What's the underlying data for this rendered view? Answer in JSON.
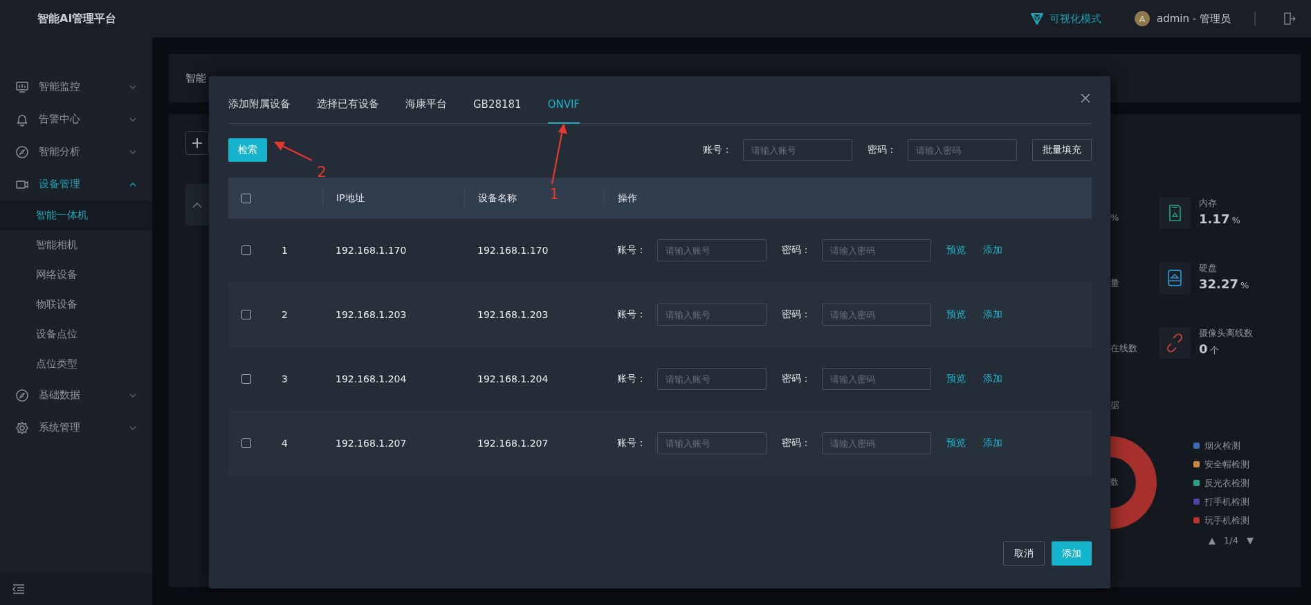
{
  "header": {
    "title": "智能AI管理平台",
    "mode_link": "可视化模式",
    "avatar": "A",
    "user": "admin - 管理员"
  },
  "sidebar": {
    "items": [
      {
        "label": "智能监控",
        "expanded": false,
        "selected": false
      },
      {
        "label": "告警中心",
        "expanded": false,
        "selected": false
      },
      {
        "label": "智能分析",
        "expanded": false,
        "selected": false
      },
      {
        "label": "设备管理",
        "expanded": true,
        "selected": true,
        "children": [
          {
            "label": "智能一体机",
            "selected": true
          },
          {
            "label": "智能相机",
            "selected": false
          },
          {
            "label": "网络设备",
            "selected": false
          },
          {
            "label": "物联设备",
            "selected": false
          },
          {
            "label": "设备点位",
            "selected": false
          },
          {
            "label": "点位类型",
            "selected": false
          }
        ]
      },
      {
        "label": "基础数据",
        "expanded": false,
        "selected": false
      },
      {
        "label": "系统管理",
        "expanded": false,
        "selected": false
      }
    ]
  },
  "breadcrumb": "智能",
  "dashboard": {
    "fragments": [
      "%",
      "量",
      "在线数"
    ],
    "stats": [
      {
        "label": "内存",
        "value": "1.17",
        "unit": "%"
      },
      {
        "label": "硬盘",
        "value": "32.27",
        "unit": "%"
      },
      {
        "label": "摄像头离线数",
        "value": "0",
        "unit": "个"
      }
    ],
    "section_fragment": "据",
    "donut_fragment": "数",
    "legend": [
      {
        "label": "烟火检测",
        "color": "#3a6db3"
      },
      {
        "label": "安全帽检测",
        "color": "#c8893a"
      },
      {
        "label": "反光衣检测",
        "color": "#2aa28b"
      },
      {
        "label": "打手机检测",
        "color": "#4a44a8"
      },
      {
        "label": "玩手机检测",
        "color": "#b9322f"
      }
    ],
    "pager": {
      "prev": "▲",
      "page": "1/4",
      "next": "▼"
    }
  },
  "modal": {
    "tabs": [
      {
        "label": "添加附属设备",
        "selected": false
      },
      {
        "label": "选择已有设备",
        "selected": false
      },
      {
        "label": "海康平台",
        "selected": false
      },
      {
        "label": "GB28181",
        "selected": false
      },
      {
        "label": "ONVIF",
        "selected": true
      }
    ],
    "search_button": "检索",
    "account_label": "账号：",
    "account_placeholder": "请输入账号",
    "password_label": "密码：",
    "password_placeholder": "请输入密码",
    "batch_button": "批量填充",
    "table": {
      "header_checked": false,
      "columns": [
        "IP地址",
        "设备名称",
        "操作"
      ],
      "rows": [
        {
          "checked": false,
          "index": "1",
          "ip": "192.168.1.170",
          "name": "192.168.1.170",
          "account_label": "账号：",
          "account_placeholder": "请输入账号",
          "password_label": "密码：",
          "password_placeholder": "请输入密码",
          "actions": [
            "预览",
            "添加"
          ]
        },
        {
          "checked": false,
          "index": "2",
          "ip": "192.168.1.203",
          "name": "192.168.1.203",
          "account_label": "账号：",
          "account_placeholder": "请输入账号",
          "password_label": "密码：",
          "password_placeholder": "请输入密码",
          "actions": [
            "预览",
            "添加"
          ]
        },
        {
          "checked": false,
          "index": "3",
          "ip": "192.168.1.204",
          "name": "192.168.1.204",
          "account_label": "账号：",
          "account_placeholder": "请输入账号",
          "password_label": "密码：",
          "password_placeholder": "请输入密码",
          "actions": [
            "预览",
            "添加"
          ]
        },
        {
          "checked": false,
          "index": "4",
          "ip": "192.168.1.207",
          "name": "192.168.1.207",
          "account_label": "账号：",
          "account_placeholder": "请输入账号",
          "password_label": "密码：",
          "password_placeholder": "请输入密码",
          "actions": [
            "预览",
            "添加"
          ]
        }
      ]
    },
    "cancel_button": "取消",
    "confirm_button": "添加",
    "annotations": [
      {
        "label": "1"
      },
      {
        "label": "2"
      }
    ]
  }
}
